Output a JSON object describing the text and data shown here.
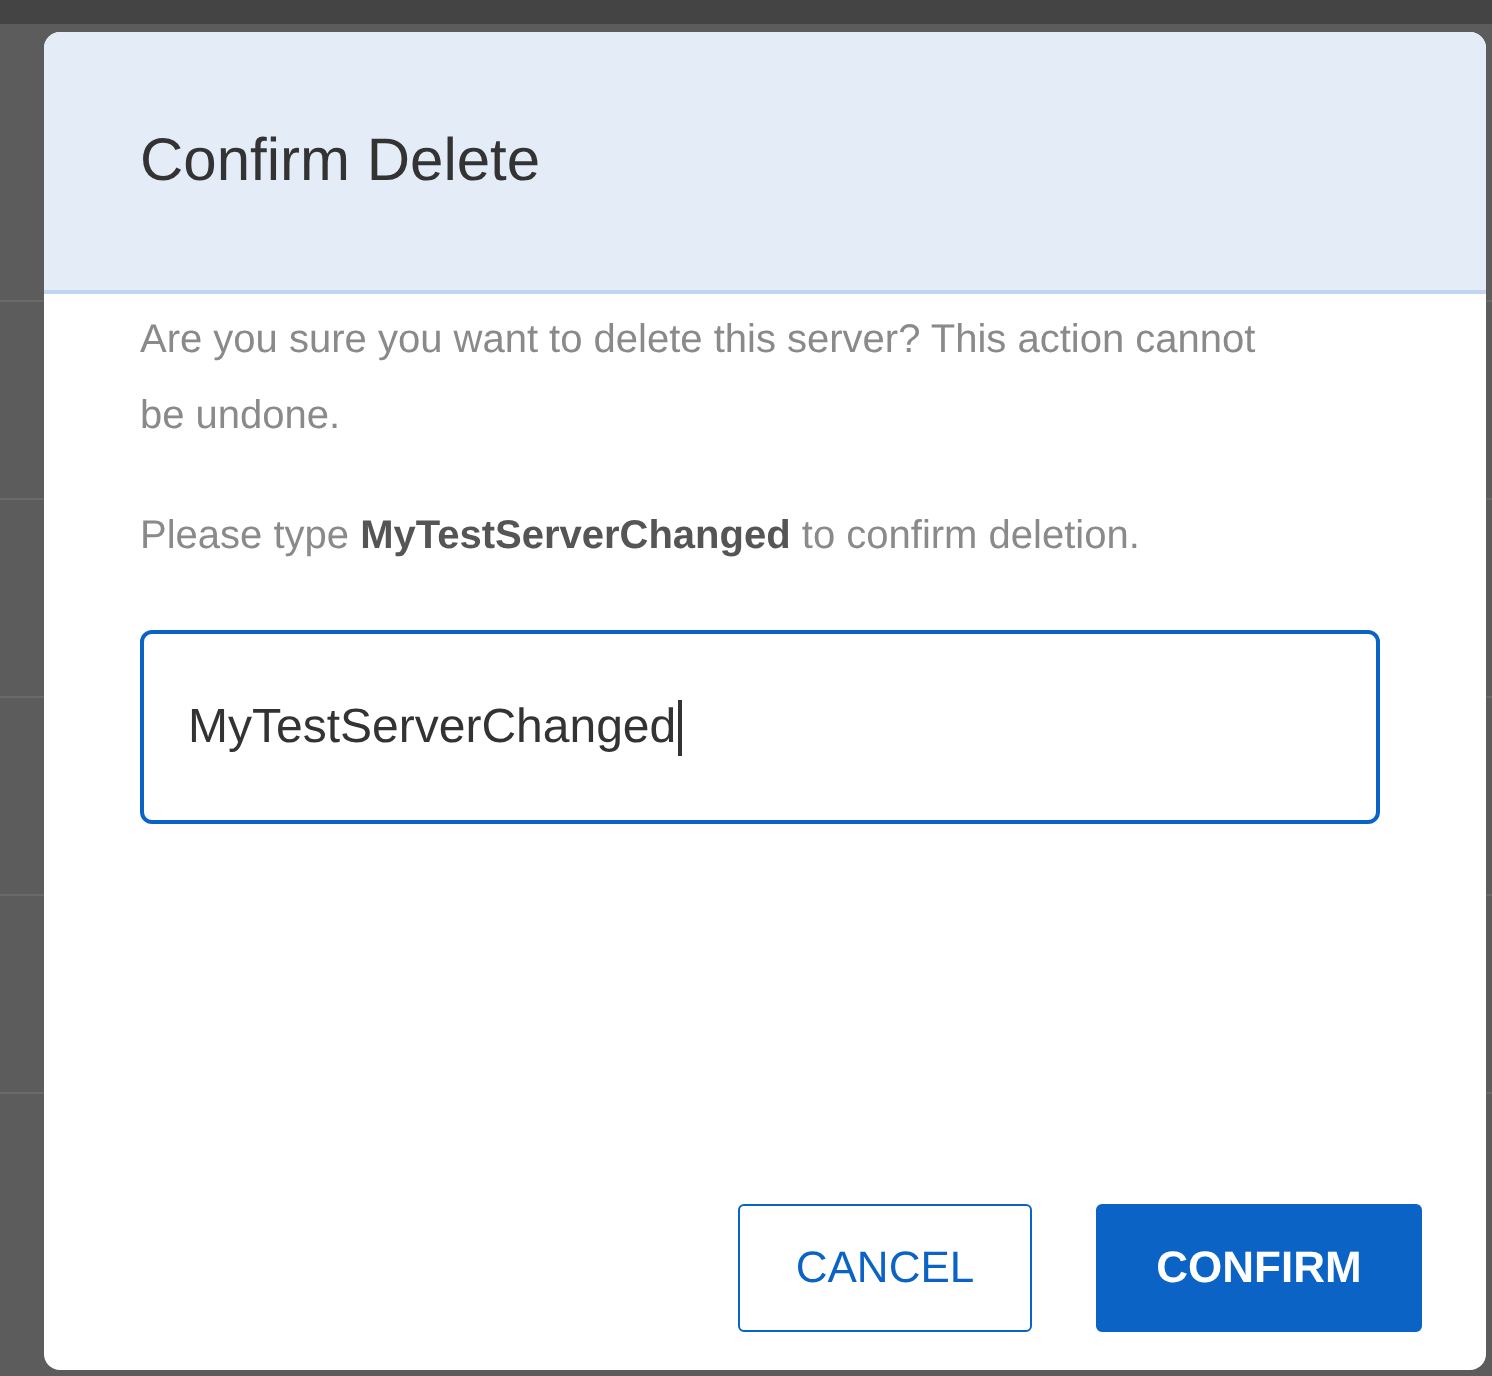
{
  "dialog": {
    "title": "Confirm Delete",
    "paragraphs": [
      "Are you sure you want to delete this server? This action cannot be undone.",
      "Please type **MyTestServerChanged** to confirm deletion."
    ],
    "input": {
      "value": "MyTestServerChanged",
      "focused": true
    },
    "buttons": [
      {
        "label": "CANCEL",
        "kind": "secondary"
      },
      {
        "label": "CONFIRM",
        "kind": "primary"
      }
    ]
  }
}
